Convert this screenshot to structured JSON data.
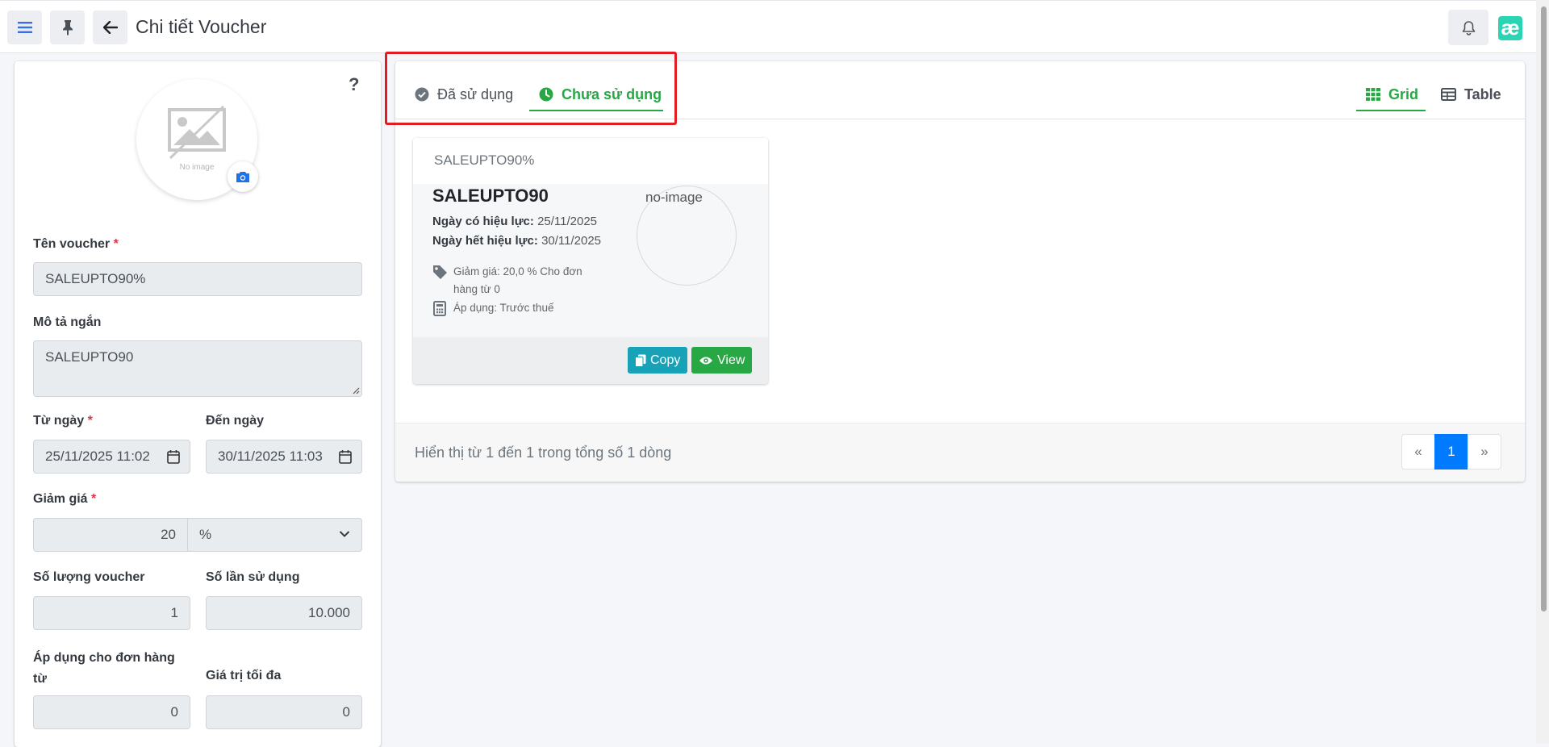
{
  "header": {
    "title": "Chi tiết Voucher",
    "logo_text": "æ"
  },
  "form": {
    "avatar_caption": "No image",
    "help": "?",
    "name": {
      "label": "Tên voucher",
      "required": "*",
      "value": "SALEUPTO90%"
    },
    "description": {
      "label": "Mô tả ngắn",
      "value": "SALEUPTO90"
    },
    "from_date": {
      "label": "Từ ngày",
      "required": "*",
      "value": "25/11/2025 11:02"
    },
    "to_date": {
      "label": "Đến ngày",
      "value": "30/11/2025 11:03"
    },
    "discount": {
      "label": "Giảm giá",
      "required": "*",
      "value": "20",
      "unit": "%"
    },
    "quantity": {
      "label": "Số lượng voucher",
      "value": "1"
    },
    "usage_count": {
      "label": "Số lần sử dụng",
      "value": "10.000"
    },
    "min_order": {
      "label_line1": "Áp dụng cho đơn hàng",
      "label_line2": "từ",
      "value": "0"
    },
    "max_value": {
      "label": "Giá trị tối đa",
      "value": "0"
    }
  },
  "tabs": {
    "used": "Đã sử dụng",
    "unused": "Chưa sử dụng"
  },
  "views": {
    "grid": "Grid",
    "table": "Table"
  },
  "voucher_card": {
    "title": "SALEUPTO90%",
    "code": "SALEUPTO90",
    "valid_from_label": "Ngày có hiệu lực:",
    "valid_from": "25/11/2025",
    "valid_to_label": "Ngày hết hiệu lực:",
    "valid_to": "30/11/2025",
    "discount_line1": "Giảm giá: 20,0 % Cho đơn",
    "discount_line2": "hàng từ 0",
    "apply": "Áp dụng: Trước thuế",
    "image_alt": "no-image",
    "copy_label": "Copy",
    "view_label": "View"
  },
  "list_footer": {
    "summary": "Hiển thị từ 1 đến 1 trong tổng số 1 dòng",
    "prev": "«",
    "page": "1",
    "next": "»"
  },
  "colors": {
    "accent_green": "#28a745",
    "highlight_red": "#e31b23",
    "primary_blue": "#007bff",
    "info_teal": "#17a2b8"
  }
}
